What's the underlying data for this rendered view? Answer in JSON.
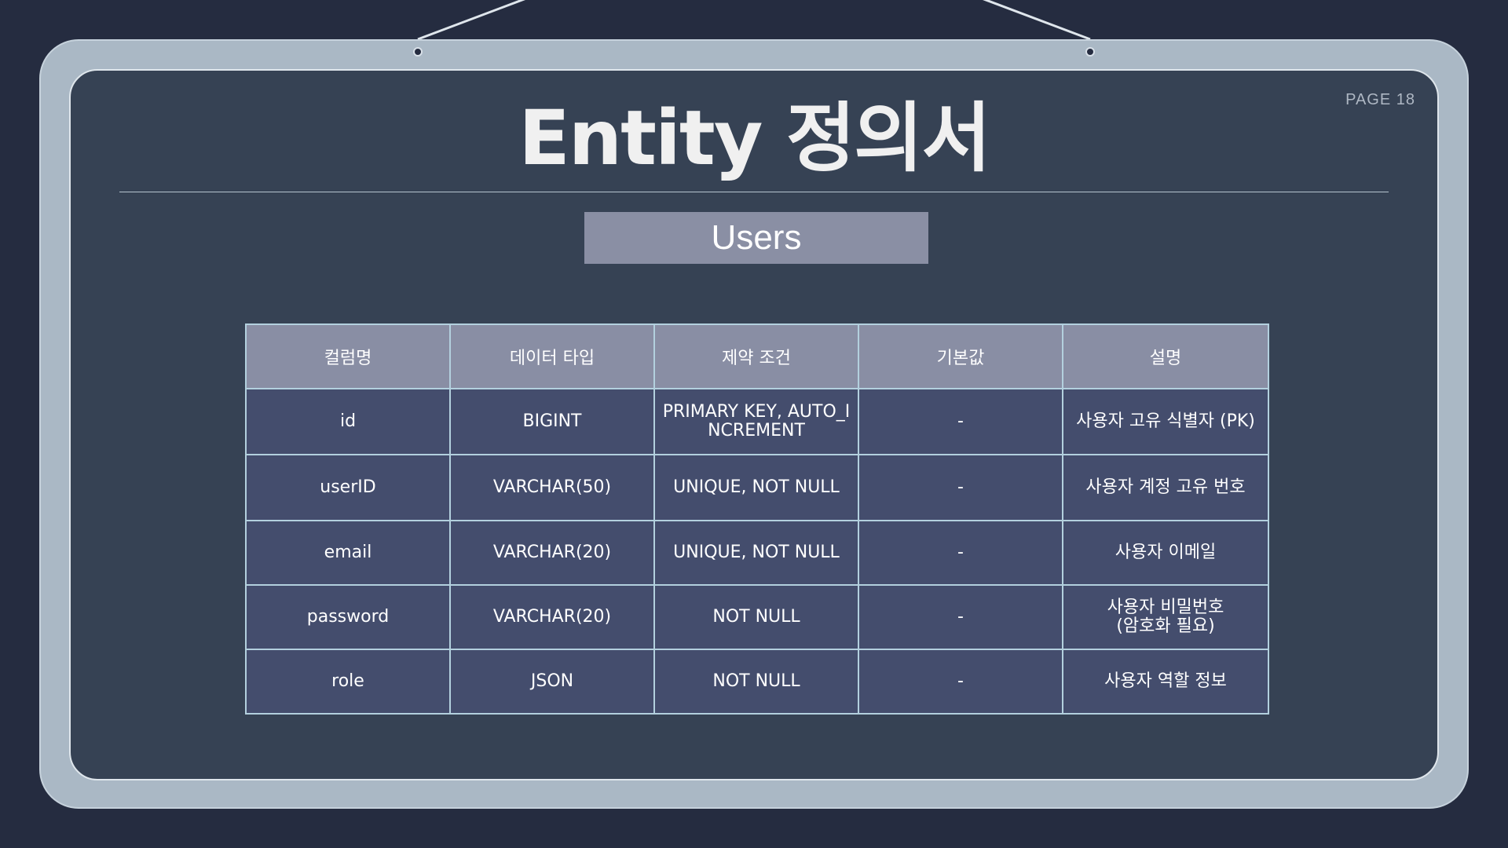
{
  "page": {
    "number_label": "PAGE 18",
    "title": "Entity 정의서"
  },
  "entity": {
    "name": "Users"
  },
  "table": {
    "headers": [
      "컬럼명",
      "데이터 타입",
      "제약 조건",
      "기본값",
      "설명"
    ],
    "rows": [
      [
        "id",
        "BIGINT",
        "PRIMARY KEY, AUTO_INCREMENT",
        "-",
        "사용자 고유 식별자 (PK)"
      ],
      [
        "userID",
        "VARCHAR(50)",
        "UNIQUE, NOT NULL",
        "-",
        "사용자 계정 고유 번호"
      ],
      [
        "email",
        "VARCHAR(20)",
        "UNIQUE, NOT NULL",
        "-",
        "사용자 이메일"
      ],
      [
        "password",
        "VARCHAR(20)",
        "NOT NULL",
        "-",
        "사용자 비밀번호\n(암호화 필요)"
      ],
      [
        "role",
        "JSON",
        "NOT NULL",
        "-",
        "사용자 역할 정보"
      ]
    ]
  },
  "colors": {
    "background": "#252c40",
    "board_frame": "#aab8c5",
    "board_surface": "#364254",
    "header_fill": "#898ea4",
    "row_fill": "#444d6d",
    "grid_line": "#b3d0de"
  }
}
